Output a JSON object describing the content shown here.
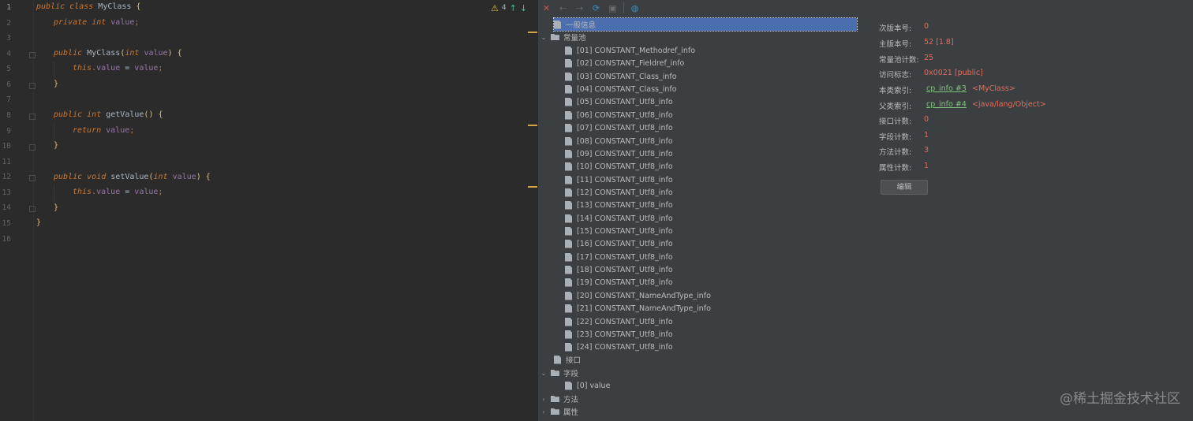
{
  "editor": {
    "line_numbers": [
      "1",
      "2",
      "3",
      "4",
      "5",
      "6",
      "7",
      "8",
      "9",
      "10",
      "11",
      "12",
      "13",
      "14",
      "15",
      "16"
    ],
    "inspection": {
      "warnings": "4"
    },
    "code": {
      "l1": {
        "kw1": "public",
        "kw2": "class",
        "cls": "MyClass",
        "brace": "{"
      },
      "l2": {
        "kw1": "private",
        "kw2": "int",
        "fld": "value",
        "semi": ";"
      },
      "l4": {
        "kw1": "public",
        "name": "MyClass",
        "open": "(",
        "kw2": "int",
        "par": "value",
        "close": ")",
        "brace": "{"
      },
      "l5": {
        "kw": "this",
        "dot": ".",
        "fld": "value",
        "eq": " = ",
        "par": "value",
        "semi": ";"
      },
      "l6": {
        "brace": "}"
      },
      "l8": {
        "kw1": "public",
        "kw2": "int",
        "name": "getValue",
        "paren": "()",
        "brace": "{"
      },
      "l9": {
        "kw": "return",
        "fld": "value",
        "semi": ";"
      },
      "l10": {
        "brace": "}"
      },
      "l12": {
        "kw1": "public",
        "kw2": "void",
        "name": "setValue",
        "open": "(",
        "kw3": "int",
        "par": "value",
        "close": ")",
        "brace": "{"
      },
      "l13": {
        "kw": "this",
        "dot": ".",
        "fld": "value",
        "eq": " = ",
        "par": "value",
        "semi": ";"
      },
      "l14": {
        "brace": "}"
      },
      "l15": {
        "brace": "}"
      }
    }
  },
  "toolbar": {
    "icons": [
      "close-icon",
      "back-icon",
      "forward-icon",
      "refresh-icon",
      "save-icon",
      "browser-icon"
    ]
  },
  "tree": {
    "general": "一般信息",
    "constant_pool": "常量池",
    "constants": [
      "[01] CONSTANT_Methodref_info",
      "[02] CONSTANT_Fieldref_info",
      "[03] CONSTANT_Class_info",
      "[04] CONSTANT_Class_info",
      "[05] CONSTANT_Utf8_info",
      "[06] CONSTANT_Utf8_info",
      "[07] CONSTANT_Utf8_info",
      "[08] CONSTANT_Utf8_info",
      "[09] CONSTANT_Utf8_info",
      "[10] CONSTANT_Utf8_info",
      "[11] CONSTANT_Utf8_info",
      "[12] CONSTANT_Utf8_info",
      "[13] CONSTANT_Utf8_info",
      "[14] CONSTANT_Utf8_info",
      "[15] CONSTANT_Utf8_info",
      "[16] CONSTANT_Utf8_info",
      "[17] CONSTANT_Utf8_info",
      "[18] CONSTANT_Utf8_info",
      "[19] CONSTANT_Utf8_info",
      "[20] CONSTANT_NameAndType_info",
      "[21] CONSTANT_NameAndType_info",
      "[22] CONSTANT_Utf8_info",
      "[23] CONSTANT_Utf8_info",
      "[24] CONSTANT_Utf8_info"
    ],
    "interfaces": "接口",
    "fields": "字段",
    "field_items": [
      "[0] value"
    ],
    "methods": "方法",
    "attributes": "属性"
  },
  "info": {
    "minor_version": {
      "label": "次版本号:",
      "value": "0"
    },
    "major_version": {
      "label": "主版本号:",
      "value": "52 [1.8]"
    },
    "cp_count": {
      "label": "常量池计数:",
      "value": "25"
    },
    "access_flags": {
      "label": "访问标志:",
      "value": "0x0021 [public]"
    },
    "this_class": {
      "label": "本类索引:",
      "link": "cp_info #3",
      "extra": "<MyClass>"
    },
    "super_class": {
      "label": "父类索引:",
      "link": "cp_info #4",
      "extra": "<java/lang/Object>"
    },
    "interfaces_count": {
      "label": "接口计数:",
      "value": "0"
    },
    "fields_count": {
      "label": "字段计数:",
      "value": "1"
    },
    "methods_count": {
      "label": "方法计数:",
      "value": "3"
    },
    "attributes_count": {
      "label": "属性计数:",
      "value": "1"
    },
    "edit_button": "编辑"
  },
  "watermark": "@稀土掘金技术社区",
  "colors": {
    "selection": "#4b6eaf",
    "value_red": "#e06c5a",
    "link_green": "#7ec27a",
    "marker": "#d9a343"
  }
}
